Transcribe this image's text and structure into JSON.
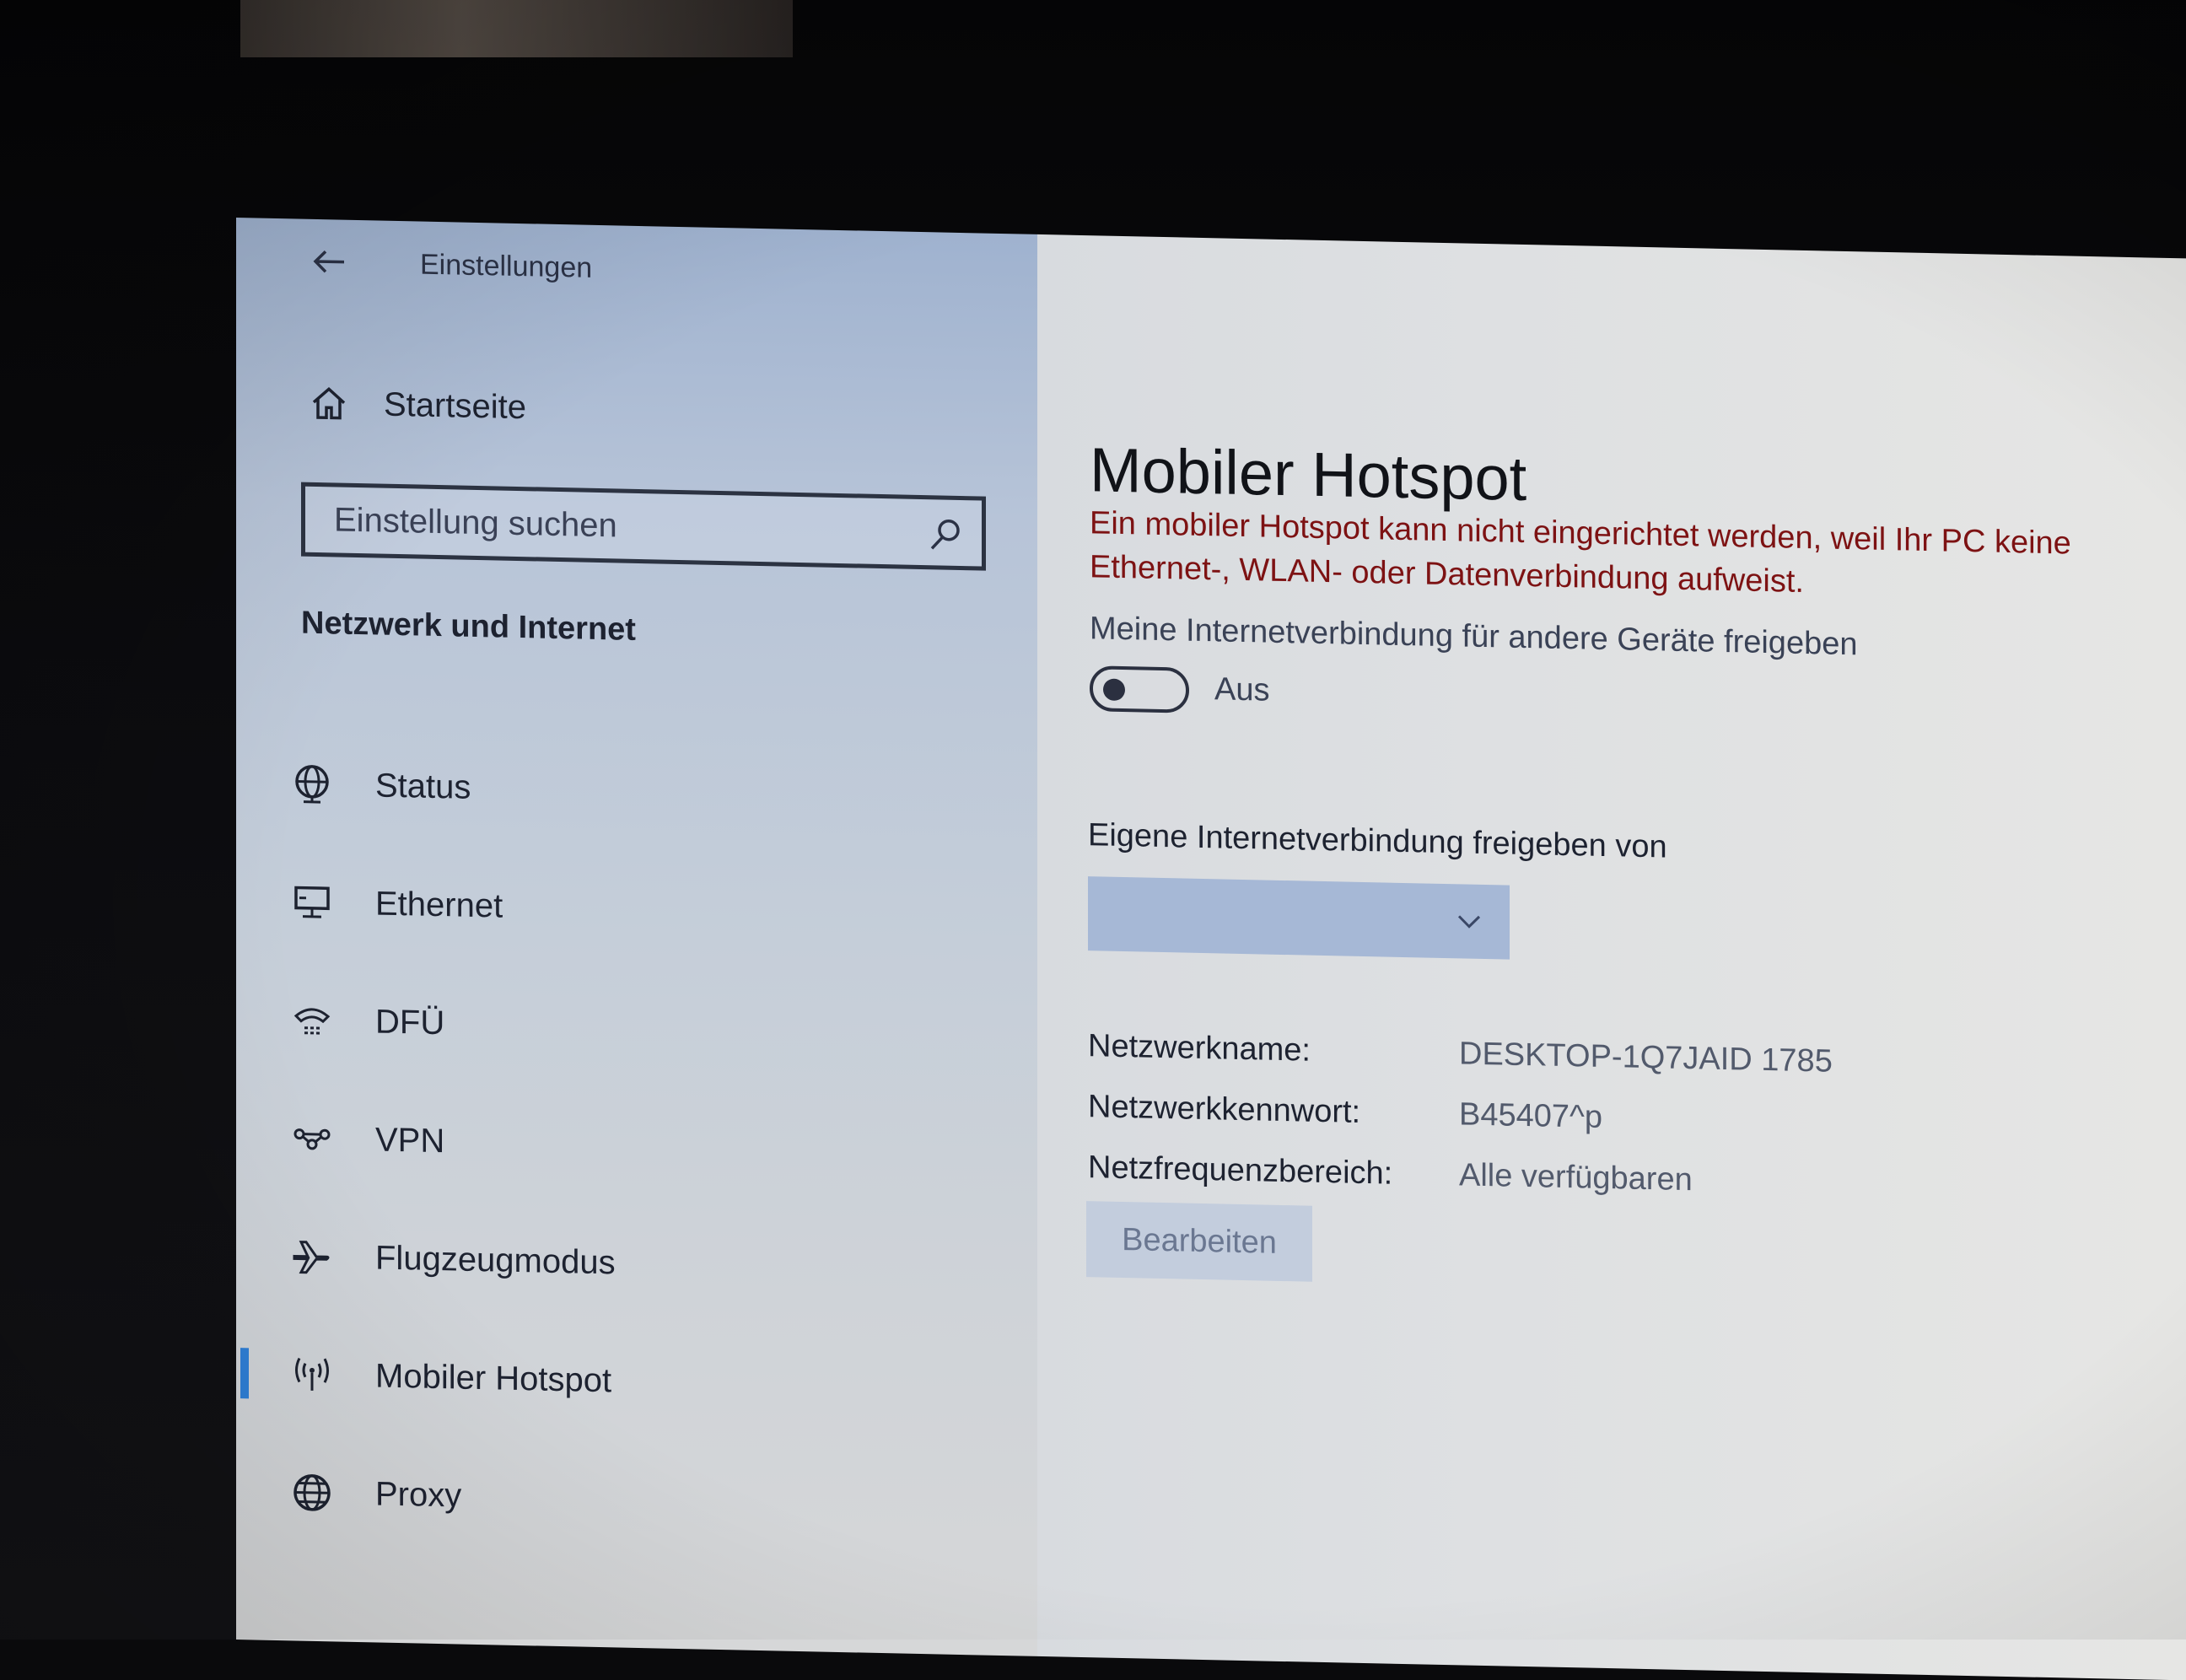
{
  "window": {
    "title": "Einstellungen"
  },
  "sidebar": {
    "home_label": "Startseite",
    "search": {
      "placeholder": "Einstellung suchen"
    },
    "section_heading": "Netzwerk und Internet",
    "items": [
      {
        "label": "Status",
        "icon": "globe-monitor-icon"
      },
      {
        "label": "Ethernet",
        "icon": "ethernet-icon"
      },
      {
        "label": "DFÜ",
        "icon": "dialup-icon"
      },
      {
        "label": "VPN",
        "icon": "vpn-icon"
      },
      {
        "label": "Flugzeugmodus",
        "icon": "airplane-icon"
      },
      {
        "label": "Mobiler Hotspot",
        "icon": "hotspot-icon",
        "selected": true
      },
      {
        "label": "Proxy",
        "icon": "globe-icon"
      }
    ]
  },
  "main": {
    "title": "Mobiler Hotspot",
    "error_line1": "Ein mobiler Hotspot kann nicht eingerichtet werden, weil Ihr PC keine",
    "error_line2": "Ethernet-, WLAN- oder Datenverbindung aufweist.",
    "share_label": "Meine Internetverbindung für andere Geräte freigeben",
    "toggle_state": "Aus",
    "source_label": "Eigene Internetverbindung freigeben von",
    "dropdown_value": "",
    "properties": [
      {
        "key": "Netzwerkname:",
        "value": "DESKTOP-1Q7JAID 1785"
      },
      {
        "key": "Netzwerkkennwort:",
        "value": "B45407^p"
      },
      {
        "key": "Netzfrequenzbereich:",
        "value": "Alle verfügbaren"
      }
    ],
    "edit_button": "Bearbeiten"
  },
  "colors": {
    "error": "#7d1213",
    "accent": "#2f7fd6",
    "dropdown_bg": "#a6b8d6"
  }
}
